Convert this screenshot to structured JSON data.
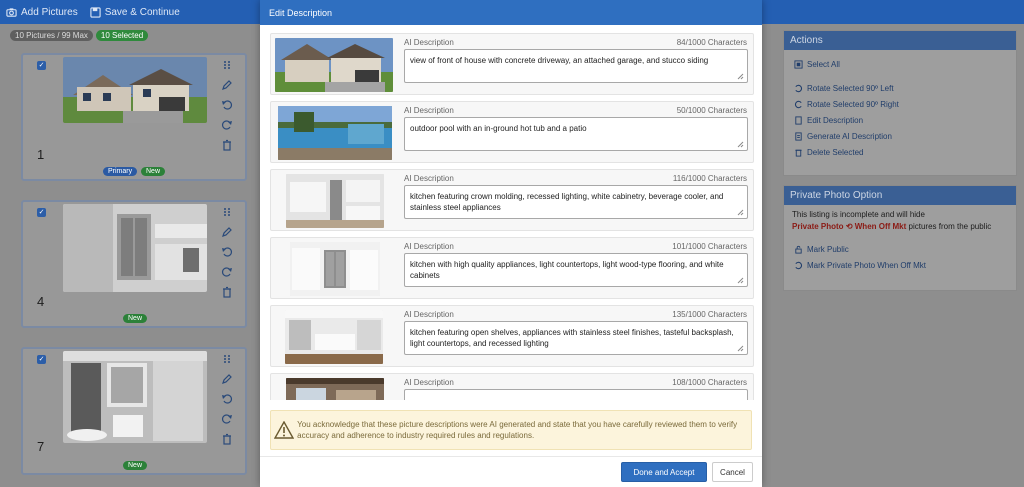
{
  "topbar": {
    "add_label": "Add Pictures",
    "save_label": "Save & Continue"
  },
  "counts": {
    "pictures": "10 Pictures / 99 Max",
    "selected": "10 Selected"
  },
  "cards": [
    {
      "number": "1",
      "badges": [
        "Primary",
        "New"
      ]
    },
    {
      "number": "4",
      "badges": [
        "New"
      ]
    },
    {
      "number": "7",
      "badges": [
        "New"
      ]
    }
  ],
  "actions": {
    "title": "Actions",
    "select_all": "Select All",
    "rotate_left": "Rotate Selected 90º Left",
    "rotate_right": "Rotate Selected 90º Right",
    "edit": "Edit Description",
    "generate": "Generate AI Description",
    "delete": "Delete Selected"
  },
  "private": {
    "title": "Private Photo Option",
    "line1": "This listing is incomplete and will hide",
    "red1": "Private Photo",
    "red2": "When Off Mkt",
    "line2_tail": "pictures from the public",
    "mark_public": "Mark Public",
    "mark_private": "Mark Private Photo When Off Mkt"
  },
  "modal": {
    "title": "Edit Description",
    "label": "AI Description",
    "items": [
      {
        "count": "84/1000 Characters",
        "text": "view of front of house with concrete driveway, an attached garage, and stucco siding"
      },
      {
        "count": "50/1000 Characters",
        "text": "outdoor pool with an in-ground hot tub and a patio"
      },
      {
        "count": "116/1000 Characters",
        "text": "kitchen featuring crown molding, recessed lighting, white cabinetry, beverage cooler, and stainless steel appliances"
      },
      {
        "count": "101/1000 Characters",
        "text": "kitchen with high quality appliances, light countertops, light wood-type flooring, and white cabinets"
      },
      {
        "count": "135/1000 Characters",
        "text": "kitchen featuring open shelves, appliances with stainless steel finishes, tasteful backsplash, light countertops, and recessed lighting"
      },
      {
        "count": "108/1000 Characters",
        "text": ""
      }
    ],
    "notice": "You acknowledge that these picture descriptions were AI generated and state that you have carefully reviewed them to verify accuracy and adherence to industry required rules and regulations.",
    "accept": "Done and Accept",
    "cancel": "Cancel"
  },
  "colors": {
    "header": "#2f6fc0",
    "topbar": "#245fb3",
    "warning_bg": "#fcf4dc"
  }
}
